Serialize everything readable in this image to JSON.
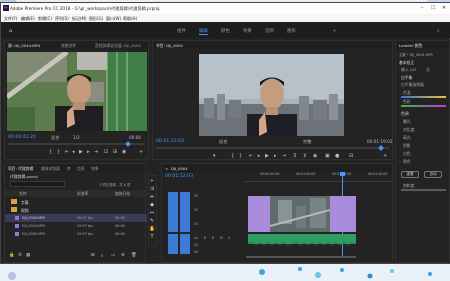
{
  "app": {
    "title": "Adobe Premiere Pro CC 2018 - G:\\pr_workspace\\代理剪辑\\代理剪辑.prproj",
    "logo": "Pr"
  },
  "menu": [
    "文件(F)",
    "编辑(E)",
    "剪辑(C)",
    "序列(S)",
    "标记(M)",
    "图形(G)",
    "窗口(W)",
    "帮助(H)"
  ],
  "workspaces": {
    "items": [
      "组件",
      "编辑",
      "颜色",
      "效果",
      "音频",
      "图形"
    ],
    "active": "编辑"
  },
  "source_monitor": {
    "tabs": [
      "源: DJI_0044.MP4",
      "效果控件",
      "音频剪辑混合器: DJI_0004"
    ],
    "timecode_left": "00:00:42:20",
    "fit": "适合",
    "page": "1/2",
    "timecode_right": "00:00"
  },
  "program_monitor": {
    "tab": "节目: DJI_0004",
    "timecode_left": "00:01:12:03",
    "fit": "适合",
    "page": "完整",
    "timecode_right": "00:01:19:03"
  },
  "project_panel": {
    "tabs": [
      "项目: 代理剪辑",
      "媒体浏览器",
      "库",
      "信息",
      "效果"
    ],
    "filename": "代理剪辑.prproj",
    "search_placeholder": "",
    "item_count": "1 项已选择，共 6 项",
    "columns": [
      "名称",
      "帧速率",
      "媒体开始"
    ],
    "rows": [
      {
        "name": "字幕",
        "fps": "",
        "start": ""
      },
      {
        "name": "视频",
        "fps": "",
        "start": ""
      },
      {
        "name": "DJI_0004.MP4",
        "fps": "29.97 fps",
        "start": "00:00"
      },
      {
        "name": "DJI_0044.MP4",
        "fps": "29.97 fps",
        "start": "00:00"
      },
      {
        "name": "DJI_0006.MP4",
        "fps": "29.97 fps",
        "start": "00:00"
      }
    ]
  },
  "timeline": {
    "tab": "DJI_0004",
    "timecode": "00:01:12:03",
    "ruler": [
      "00:00:50:00",
      "00:01:00:00",
      "00:01:10:00",
      "00:01:20:00"
    ],
    "tracks": [
      "V3",
      "V2",
      "V1",
      "A1",
      "A2",
      "A3"
    ],
    "track_toggle_labels": [
      "6",
      "8",
      "M",
      "S"
    ]
  },
  "lumetri": {
    "tab": "Lumetri 颜色",
    "master": "主要 * DJI_0004.MP4",
    "sections": [
      "基本校正",
      "输入 LUT",
      "无",
      "白平衡",
      "白平衡选择器",
      "色温",
      "色彩",
      "色调",
      "曝光",
      "对比度",
      "高光",
      "阴影",
      "白色",
      "黑色",
      "重置",
      "自动",
      "饱和度"
    ]
  }
}
